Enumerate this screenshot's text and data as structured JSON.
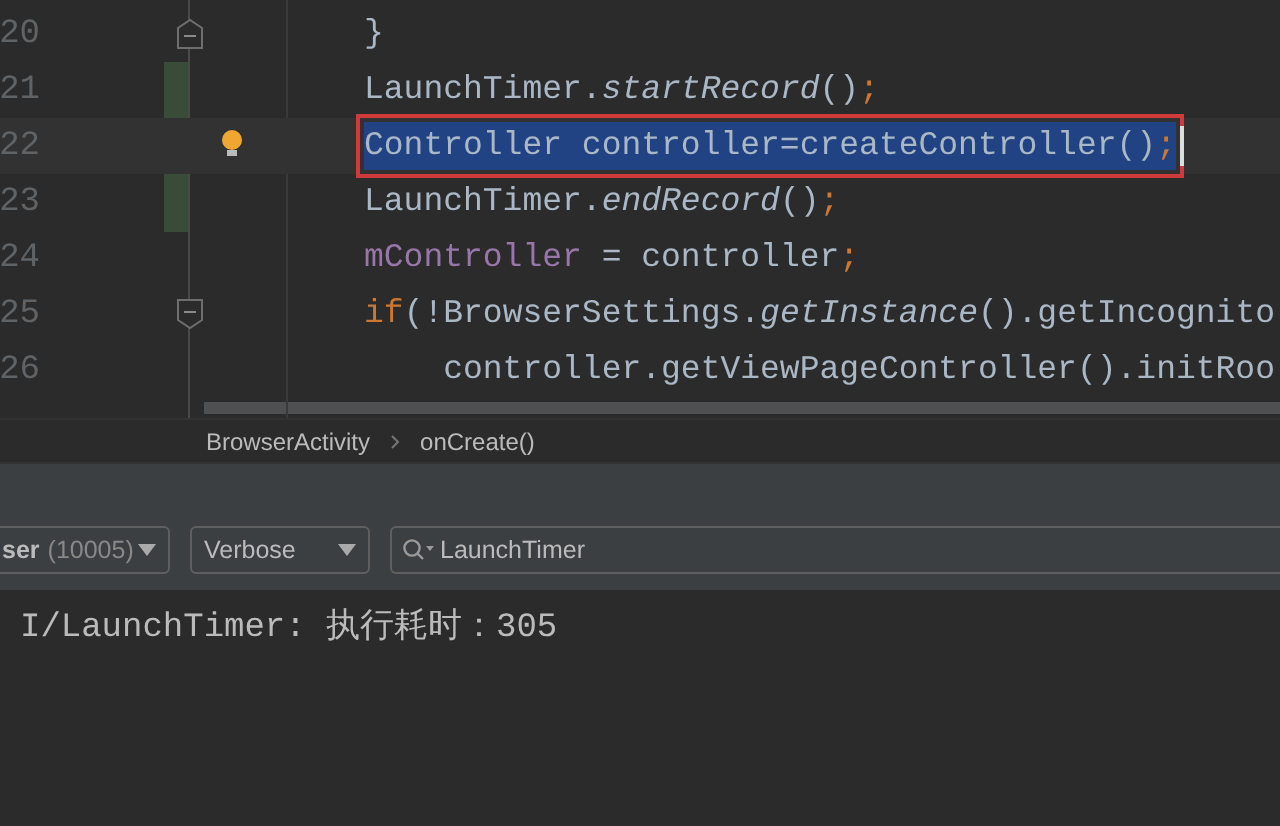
{
  "editor": {
    "lines": [
      {
        "number": "20",
        "fold_start": false,
        "fold_end": true,
        "changed": false,
        "hint": false,
        "selected": false,
        "tokens": [
          {
            "kind": "plain",
            "text": "}"
          }
        ]
      },
      {
        "number": "21",
        "fold_start": false,
        "fold_end": false,
        "changed": true,
        "hint": false,
        "selected": false,
        "tokens": [
          {
            "kind": "plain",
            "text": "LaunchTimer."
          },
          {
            "kind": "method",
            "text": "startRecord"
          },
          {
            "kind": "plain",
            "text": "()"
          },
          {
            "kind": "keyword",
            "text": ";"
          }
        ]
      },
      {
        "number": "22",
        "fold_start": false,
        "fold_end": false,
        "changed": false,
        "hint": true,
        "selected": true,
        "tokens": [
          {
            "kind": "plain",
            "text": "Controller controller=createController()"
          },
          {
            "kind": "keyword",
            "text": ";"
          }
        ]
      },
      {
        "number": "23",
        "fold_start": false,
        "fold_end": false,
        "changed": true,
        "hint": false,
        "selected": false,
        "tokens": [
          {
            "kind": "plain",
            "text": "LaunchTimer."
          },
          {
            "kind": "method",
            "text": "endRecord"
          },
          {
            "kind": "plain",
            "text": "()"
          },
          {
            "kind": "keyword",
            "text": ";"
          }
        ]
      },
      {
        "number": "24",
        "fold_start": false,
        "fold_end": false,
        "changed": false,
        "hint": false,
        "selected": false,
        "tokens": [
          {
            "kind": "field",
            "text": "mController"
          },
          {
            "kind": "plain",
            "text": " = controller"
          },
          {
            "kind": "keyword",
            "text": ";"
          }
        ]
      },
      {
        "number": "25",
        "fold_start": true,
        "fold_end": false,
        "changed": false,
        "hint": false,
        "selected": false,
        "tokens": [
          {
            "kind": "keyword",
            "text": "if"
          },
          {
            "kind": "plain",
            "text": "(!BrowserSettings."
          },
          {
            "kind": "method",
            "text": "getInstance"
          },
          {
            "kind": "plain",
            "text": "().getIncognito"
          }
        ]
      },
      {
        "number": "26",
        "fold_start": false,
        "fold_end": false,
        "changed": false,
        "hint": false,
        "selected": false,
        "tokens": [
          {
            "kind": "plain",
            "text": "    controller.getViewPageController().initRoo"
          }
        ]
      }
    ]
  },
  "breadcrumbs": [
    "BrowserActivity",
    "onCreate()"
  ],
  "logcat": {
    "process": {
      "name": "ser",
      "pid": "(10005)"
    },
    "level": "Verbose",
    "search": {
      "value": "LaunchTimer"
    },
    "lines": [
      "I/LaunchTimer: 执行耗时：305"
    ]
  }
}
